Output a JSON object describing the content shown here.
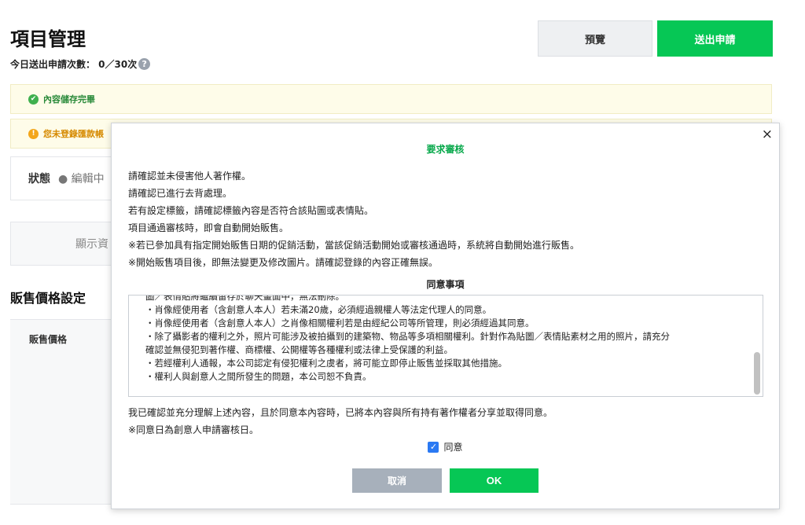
{
  "page": {
    "title": "項目管理",
    "submit_count_label": "今日送出申請次數： 0／30次",
    "help_icon": "?"
  },
  "header": {
    "preview_label": "預覽",
    "submit_label": "送出申請"
  },
  "alerts": {
    "saved_text": "內容儲存完畢",
    "warn_text": "您未登錄匯款帳"
  },
  "status": {
    "label": "狀態",
    "value": "● 編輯中"
  },
  "display_box": {
    "text": "顯示資"
  },
  "pricing": {
    "section_title": "販售價格設定",
    "price_label": "販售價格"
  },
  "modal": {
    "close_icon": "×",
    "title": "要求審核",
    "requirements": [
      "請確認並未侵害他人著作權。",
      "請確認已進行去背處理。",
      "若有設定標籤，請確認標籤內容是否符合該貼圖或表情貼。",
      "項目通過審核時，即會自動開始販售。",
      "※若已參加具有指定開始販售日期的促銷活動，當該促銷活動開始或審核通過時，系統將自動開始進行販售。",
      "※開始販售項目後，即無法變更及修改圖片。請確認登錄的內容正確無誤。"
    ],
    "agreement_title": "同意事項",
    "terms": [
      "圖／表情貼將繼續留存於聊天畫面中，無法刪除。",
      "・肖像經使用者（含創意人本人）若未滿20歲，必須經過親權人等法定代理人的同意。",
      "・肖像經使用者（含創意人本人）之肖像相關權利若是由經紀公司等所管理，則必須經過其同意。",
      "・除了攝影者的權利之外，照片可能涉及被拍攝到的建築物、物品等多項相關權利。針對作為貼圖／表情貼素材之用的照片，請充分",
      "確認並無侵犯到著作權、商標權、公開權等各種權利或法律上受保護的利益。",
      "・若經權利人通報，本公司認定有侵犯權利之虞者，將可能立即停止販售並採取其他措施。",
      "・權利人與創意人之間所發生的問題，本公司恕不負責。"
    ],
    "confirm_lines": [
      "我已確認並充分理解上述內容，且於同意本內容時，已將本內容與所有持有著作權者分享並取得同意。",
      "※同意日為創意人申請審核日。"
    ],
    "agree_checkbox_label": "同意",
    "agree_checked": true,
    "cancel_label": "取消",
    "ok_label": "OK"
  }
}
